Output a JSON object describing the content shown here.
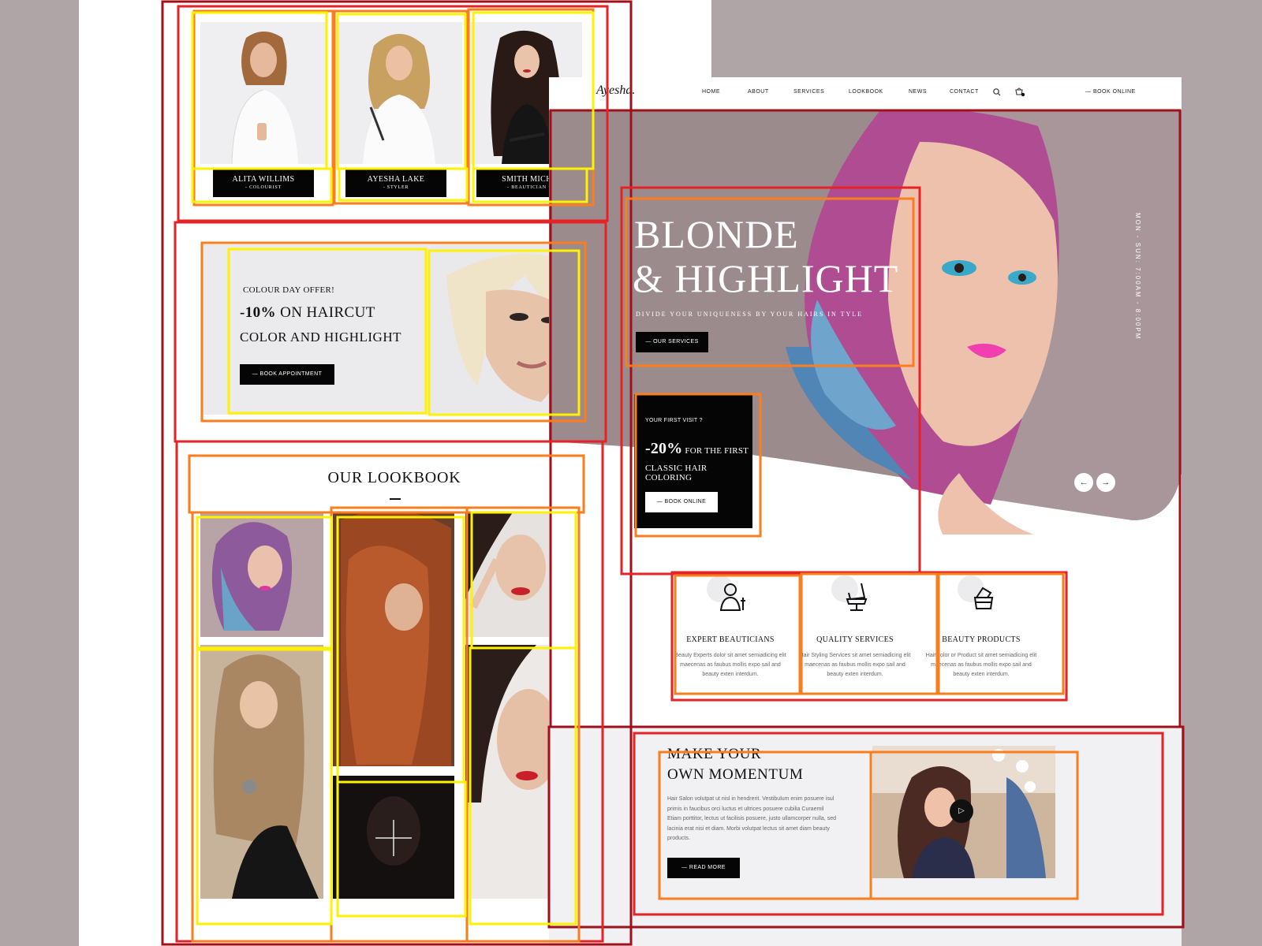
{
  "team": [
    {
      "name": "ALITA WILLIMS",
      "role": "- COLOURIST"
    },
    {
      "name": "AYESHA LAKE",
      "role": "- STYLER"
    },
    {
      "name": "SMITH MICH",
      "role": "- BEAUTICIAN"
    }
  ],
  "offer": {
    "label": "COLOUR DAY OFFER!",
    "percent": "-10%",
    "line1_rest": " ON HAIRCUT",
    "line2": "COLOR AND HIGHLIGHT",
    "button": "— BOOK APPOINTMENT"
  },
  "lookbook": {
    "title": "OUR LOOKBOOK",
    "plus": "+"
  },
  "nav": {
    "logo": "Ayesha.",
    "items": [
      "HOME",
      "ABOUT",
      "SERVICES",
      "LOOKBOOK",
      "NEWS",
      "CONTACT"
    ],
    "book": "— BOOK ONLINE"
  },
  "hero": {
    "title_line1": "BLONDE",
    "title_line2": "& HIGHLIGHT",
    "subtitle": "DIVIDE YOUR UNIQUENESS BY YOUR HAIRS IN TYLE",
    "button": "— OUR SERVICES",
    "hours": "MON - SUN: 7:00AM - 8:00PM",
    "prev": "←",
    "next": "→"
  },
  "visit": {
    "label": "YOUR FIRST VISIT ?",
    "percent": "-20%",
    "line1_rest": " FOR THE FIRST",
    "line2": "CLASSIC HAIR COLORING",
    "button": "— BOOK ONLINE"
  },
  "features": [
    {
      "title": "EXPERT BEAUTICIANS",
      "desc": "Beauty Experts dolor sit amet semiadicing elit maecenas as faubus mollis expo sail and beauty exten interdum.",
      "icon": "beautician-icon"
    },
    {
      "title": "QUALITY SERVICES",
      "desc": "Hair Styling Services sit amet semiadicing elit maecenas as faubus mollis expo sail and beauty exten interdum.",
      "icon": "salon-chair-icon"
    },
    {
      "title": "BEAUTY PRODUCTS",
      "desc": "Hair color or Product sit amet semiadicing elit maecenas as faubus mollis expo sail and beauty exten interdum.",
      "icon": "products-icon"
    }
  ],
  "momentum": {
    "title_line1": "MAKE YOUR",
    "title_line2": "OWN MOMENTUM",
    "desc": "Hair Salon volutpat ut nisl in hendrerit. Vestibulum enim posuere isul primis in faucibus orci luctus et ultrices posuere cubilia Curaemil Etiam porttitor, lectus ut facilisis posuere, justo ullamcorper nulla, sed lacinia erat nisi et diam. Morbi volutpat lectus sit amet diam beauty products.",
    "button": "— READ MORE",
    "play": "▷"
  },
  "colors": {
    "annotation_dark": "#a0101a",
    "annotation_red": "#e52327",
    "annotation_orange": "#fb7d1e",
    "annotation_yellow": "#fff200",
    "black_button": "#050505"
  }
}
